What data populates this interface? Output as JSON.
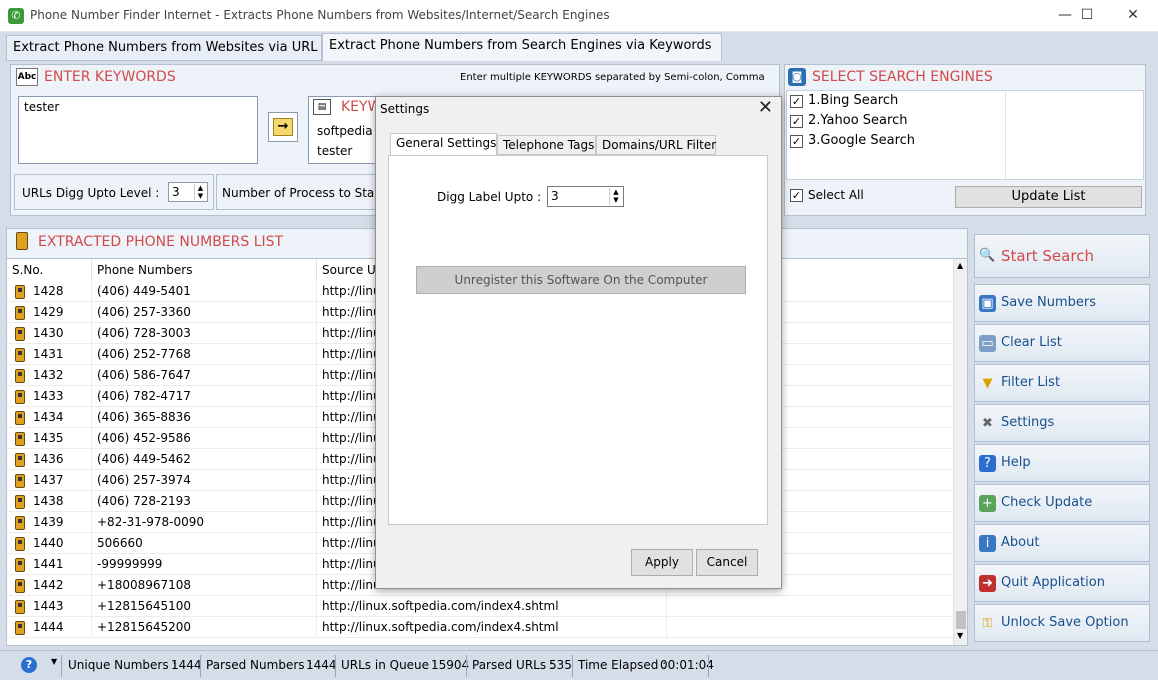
{
  "window": {
    "title": "Phone Number Finder Internet - Extracts Phone Numbers from Websites/Internet/Search Engines",
    "min_glyph": "—",
    "max_glyph": "☐",
    "close_glyph": "✕"
  },
  "top_tabs": [
    {
      "label": "Extract Phone Numbers from Websites via URL"
    },
    {
      "label": "Extract Phone Numbers from Search Engines via Keywords"
    }
  ],
  "keywords": {
    "header": "ENTER KEYWORDS",
    "hint": "Enter multiple KEYWORDS separated by Semi-colon, Comma",
    "input_value": "tester",
    "list_header": "KEYW",
    "list_items": [
      "softpedia",
      "tester"
    ],
    "digg_label": "URLs Digg Upto Level :",
    "digg_value": "3",
    "process_label": "Number of Process to Star"
  },
  "engines": {
    "header": "SELECT SEARCH ENGINES",
    "items": [
      {
        "label": "1.Bing Search",
        "checked": true
      },
      {
        "label": "2.Yahoo Search",
        "checked": true
      },
      {
        "label": "3.Google Search",
        "checked": true
      }
    ],
    "select_all": "Select All",
    "update_list": "Update List"
  },
  "list": {
    "header": "EXTRACTED PHONE NUMBERS LIST",
    "columns": [
      "S.No.",
      "Phone Numbers",
      "Source U"
    ],
    "rows": [
      {
        "sno": "1428",
        "phone": "(406) 449-5401",
        "source": "http://linu"
      },
      {
        "sno": "1429",
        "phone": "(406) 257-3360",
        "source": "http://linu"
      },
      {
        "sno": "1430",
        "phone": "(406) 728-3003",
        "source": "http://linu"
      },
      {
        "sno": "1431",
        "phone": "(406) 252-7768",
        "source": "http://linu"
      },
      {
        "sno": "1432",
        "phone": "(406) 586-7647",
        "source": "http://linu"
      },
      {
        "sno": "1433",
        "phone": "(406) 782-4717",
        "source": "http://linu"
      },
      {
        "sno": "1434",
        "phone": "(406) 365-8836",
        "source": "http://linu"
      },
      {
        "sno": "1435",
        "phone": "(406) 452-9586",
        "source": "http://linu"
      },
      {
        "sno": "1436",
        "phone": "(406) 449-5462",
        "source": "http://linu"
      },
      {
        "sno": "1437",
        "phone": "(406) 257-3974",
        "source": "http://linu"
      },
      {
        "sno": "1438",
        "phone": "(406) 728-2193",
        "source": "http://linu"
      },
      {
        "sno": "1439",
        "phone": "+82-31-978-0090",
        "source": "http://linu"
      },
      {
        "sno": "1440",
        "phone": "506660",
        "source": "http://linu"
      },
      {
        "sno": "1441",
        "phone": "-99999999",
        "source": "http://linu"
      },
      {
        "sno": "1442",
        "phone": "+18008967108",
        "source": "http://linu"
      },
      {
        "sno": "1443",
        "phone": "+12815645100",
        "source": "http://linux.softpedia.com/index4.shtml"
      },
      {
        "sno": "1444",
        "phone": "+12815645200",
        "source": "http://linux.softpedia.com/index4.shtml"
      }
    ]
  },
  "side_buttons": [
    {
      "label": "Start Search",
      "icon": "magnifier-icon"
    },
    {
      "label": "Save Numbers",
      "icon": "save-icon"
    },
    {
      "label": "Clear List",
      "icon": "clear-icon"
    },
    {
      "label": "Filter List",
      "icon": "filter-icon"
    },
    {
      "label": "Settings",
      "icon": "tools-icon"
    },
    {
      "label": "Help",
      "icon": "help-icon"
    },
    {
      "label": "Check Update",
      "icon": "update-icon"
    },
    {
      "label": "About",
      "icon": "about-icon"
    },
    {
      "label": "Quit Application",
      "icon": "exit-icon"
    },
    {
      "label": "Unlock Save Option",
      "icon": "key-icon"
    }
  ],
  "status": {
    "unique_label": "Unique Numbers :",
    "unique_value": "1444",
    "parsed_label": "Parsed Numbers :",
    "parsed_value": "1444",
    "queue_label": "URLs in Queue :",
    "queue_value": "15904",
    "parsed_urls_label": "Parsed URLs :",
    "parsed_urls_value": "535",
    "elapsed_label": "Time Elapsed :",
    "elapsed_value": "00:01:04"
  },
  "dialog": {
    "title": "Settings",
    "tabs": [
      "General Settings",
      "Telephone Tags",
      "Domains/URL Filter"
    ],
    "digg_label": "Digg Label Upto :",
    "digg_value": "3",
    "unregister": "Unregister this Software On the Computer",
    "apply": "Apply",
    "cancel": "Cancel"
  },
  "colors": {
    "accent_red": "#d04a4a",
    "link_blue": "#1a4f8a",
    "panel_bg": "#eef3f9"
  }
}
